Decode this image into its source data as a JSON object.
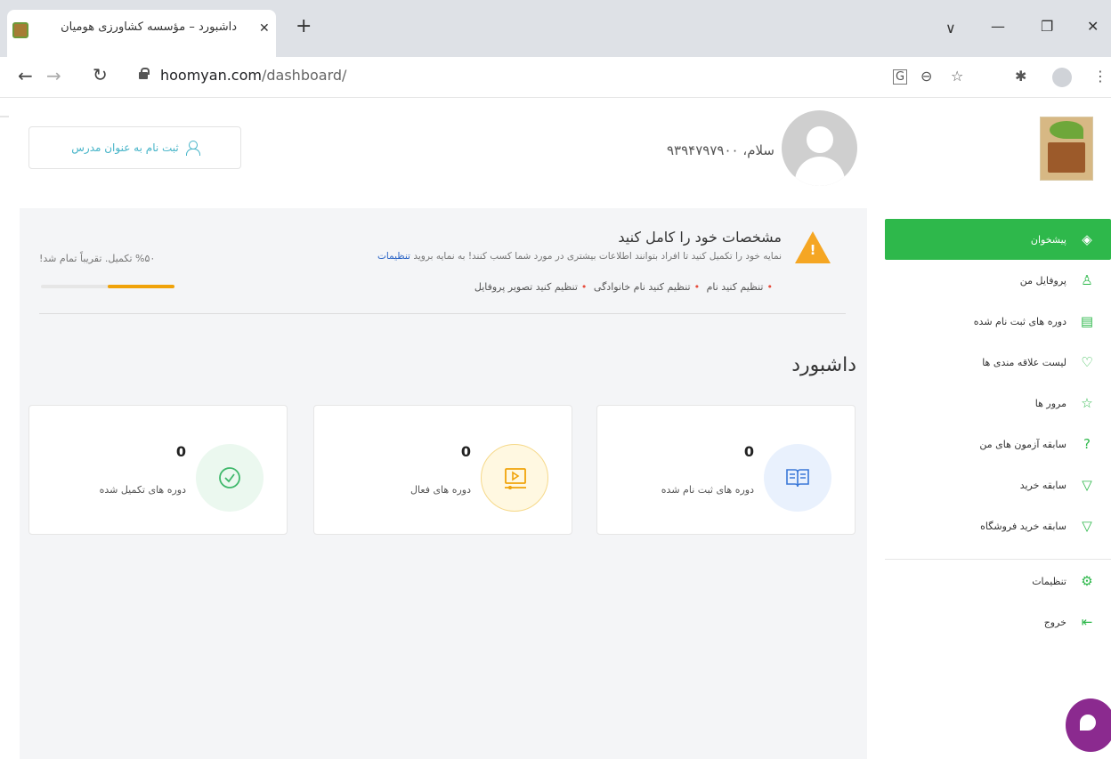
{
  "browser": {
    "tab_title": "داشبورد – مؤسسه کشاورزی هومیان",
    "tab_close": "✕",
    "new_tab": "+",
    "url_host": "hoomyan.com",
    "url_path": "/dashboard/",
    "min": "—",
    "restore": "❐",
    "close": "✕",
    "menu": "⋮"
  },
  "header": {
    "teacher_button_label": "ثبت نام به عنوان مدرس",
    "greeting": "سلام، ۹۳۹۴۷۹۷۹۰۰"
  },
  "sidebar": {
    "items": [
      {
        "label": "پیشخوان",
        "icon": "layers-icon",
        "glyph": "◈"
      },
      {
        "label": "پروفایل من",
        "icon": "user-icon",
        "glyph": "♙"
      },
      {
        "label": "دوره های ثبت نام شده",
        "icon": "book-icon",
        "glyph": "▤"
      },
      {
        "label": "لیست علاقه مندی ها",
        "icon": "heart-icon",
        "glyph": "♡"
      },
      {
        "label": "مرور ها",
        "icon": "star-icon",
        "glyph": "☆"
      },
      {
        "label": "سابقه آزمون های من",
        "icon": "question-icon",
        "glyph": "?"
      },
      {
        "label": "سابقه خرید",
        "icon": "cart-icon",
        "glyph": "▽"
      },
      {
        "label": "سابقه خرید فروشگاه",
        "icon": "cart-icon",
        "glyph": "▽"
      },
      {
        "label": "تنظیمات",
        "icon": "gear-icon",
        "glyph": "⚙"
      },
      {
        "label": "خروج",
        "icon": "logout-icon",
        "glyph": "⇤"
      }
    ]
  },
  "profile_completion": {
    "title": "مشخصات خود را کامل کنید",
    "description": "نمایه خود را تکمیل کنید تا افراد بتوانند اطلاعات بیشتری در مورد شما کسب کنند! به نمایه بروید",
    "settings_link": "تنظیمات",
    "todos": [
      "تنظیم کنید نام",
      "تنظیم کنید نام خانوادگی",
      "تنظیم کنید تصویر پروفایل"
    ],
    "progress_text": "%۵۰ تکمیل. تقریباً تمام شد!",
    "progress_fraction": 0.5,
    "warning_mark": "!"
  },
  "dashboard": {
    "title": "داشبورد",
    "cards": [
      {
        "label": "دوره های ثبت نام شده",
        "value": "0",
        "icon": "book-icon",
        "color": "#3a78d8",
        "bg": "#e9f1fd"
      },
      {
        "label": "دوره های فعال",
        "value": "0",
        "icon": "video-icon",
        "color": "#f0a30a",
        "bg": "#fff8e1"
      },
      {
        "label": "دوره های تکمیل شده",
        "value": "0",
        "icon": "check-circle-icon",
        "color": "#3fb86b",
        "bg": "#ebf8ef"
      }
    ]
  },
  "colors": {
    "accent": "#2eb84b",
    "warning": "#f5a623",
    "link": "#2c65c6",
    "teacher": "#46b4c8"
  }
}
